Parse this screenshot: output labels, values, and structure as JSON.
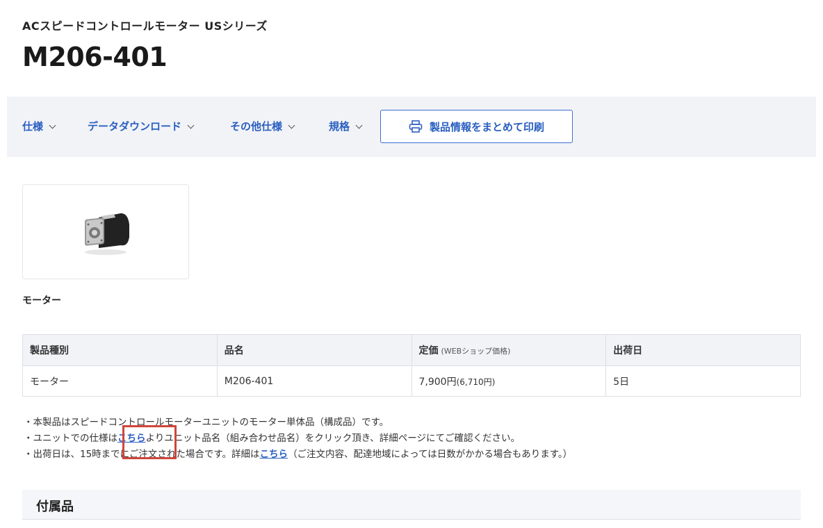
{
  "header": {
    "series": "ACスピードコントロールモーター USシリーズ",
    "model": "M206-401"
  },
  "tabs": [
    {
      "label": "仕様"
    },
    {
      "label": "データダウンロード"
    },
    {
      "label": "その他仕様"
    },
    {
      "label": "規格"
    }
  ],
  "print_button": {
    "label": "製品情報をまとめて印刷",
    "icon": "printer-icon"
  },
  "product_image": {
    "caption": "モーター"
  },
  "table": {
    "headers": {
      "type": "製品種別",
      "name": "品名",
      "price": "定価",
      "price_note": "(WEBショップ価格)",
      "ship": "出荷日"
    },
    "row": {
      "type": "モーター",
      "name": "M206-401",
      "price": "7,900円",
      "web_price": "(6,710円)",
      "ship": "5日"
    }
  },
  "notes": {
    "line1": "・本製品はスピードコントロールモーターユニットのモーター単体品（構成品）です。",
    "line2_pre": "・ユニットでの仕様は",
    "line2_link": "こちら",
    "line2_post": "よりユニット品名（組み合わせ品名）をクリック頂き、詳細ページにてご確認ください。",
    "line3_pre": "・出荷日は、15時までにご注文された場合です。詳細は",
    "line3_link": "こちら",
    "line3_post": "（ご注文内容、配達地域によっては日数がかかる場合もあります。）"
  },
  "section": {
    "title": "付属品"
  },
  "colors": {
    "link": "#2a5fc0",
    "highlight": "#d0453a",
    "tabbar_bg": "#f1f3f7"
  }
}
